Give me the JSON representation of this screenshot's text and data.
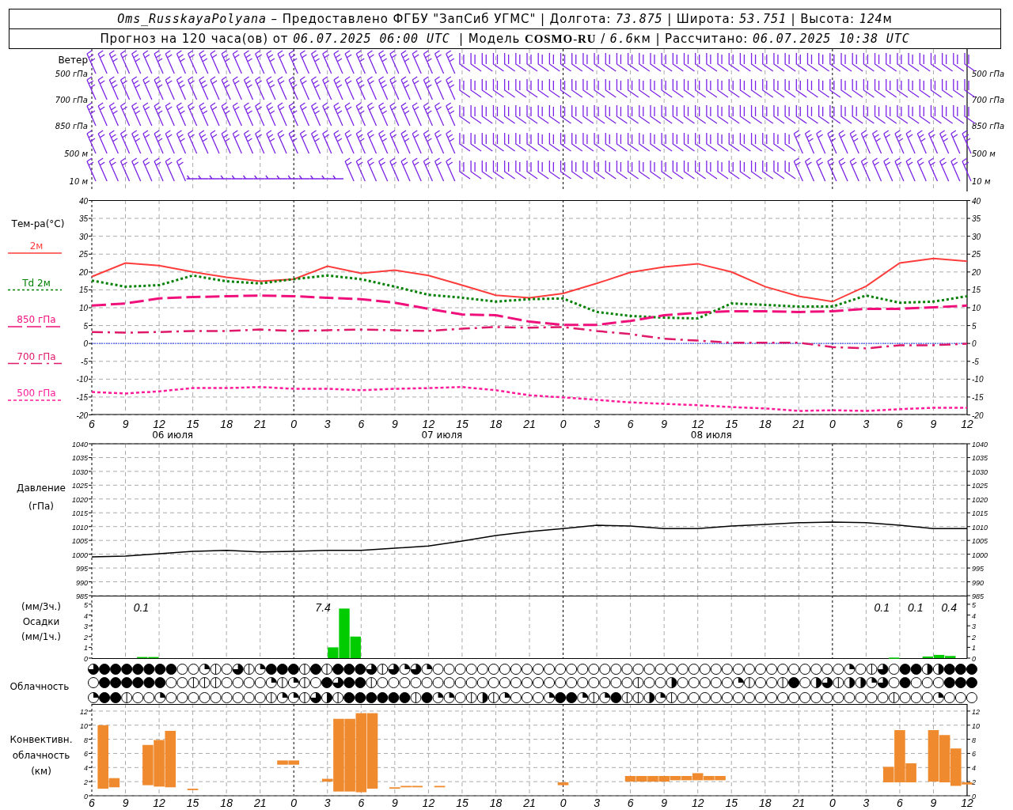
{
  "header": {
    "lines": [
      {
        "parts": [
          {
            "text": "Oms_RusskayaPolyana",
            "kind": "italic"
          },
          {
            "text": " – Предоставлено ФГБУ \"ЗапСиб УГМС\" | Долгота: ",
            "kind": "plain"
          },
          {
            "text": "73.875",
            "kind": "italic"
          },
          {
            "text": " | Широта: ",
            "kind": "plain"
          },
          {
            "text": "53.751",
            "kind": "italic"
          },
          {
            "text": " | Высота: ",
            "kind": "plain"
          },
          {
            "text": "124",
            "kind": "italic"
          },
          {
            "text": "м",
            "kind": "plain"
          }
        ]
      },
      {
        "parts": [
          {
            "text": "Прогноз на 120 часа(ов) от ",
            "kind": "plain"
          },
          {
            "text": "06.07.2025 06:00 UTC",
            "kind": "italic"
          },
          {
            "text": "  | Модель ",
            "kind": "plain"
          },
          {
            "text": "COSMO-RU",
            "kind": "bold"
          },
          {
            "text": " / ",
            "kind": "plain"
          },
          {
            "text": "6.6",
            "kind": "italic"
          },
          {
            "text": "км | Рассчитано: ",
            "kind": "plain"
          },
          {
            "text": "06.07.2025 10:38 UTC",
            "kind": "italic"
          }
        ]
      }
    ]
  },
  "wind": {
    "title": "Ветер",
    "levels": [
      "500 гПа",
      "700 гПа",
      "850 гПа",
      "500 м",
      "10  м"
    ],
    "right_levels": [
      "500 гПа",
      "700 гПа",
      "850 гПа",
      "500 м",
      "10  м"
    ]
  },
  "temperature": {
    "label": "Тем-ра(°C)",
    "dates": [
      "06 июля",
      "07 июля",
      "08 июля"
    ],
    "left_ticks": [
      "40",
      "35",
      "30",
      "25",
      "20",
      "15",
      "10",
      "5",
      "0",
      "-5",
      "-10",
      "-15",
      "-20"
    ],
    "right_ticks": [
      "40",
      "35",
      "30",
      "25",
      "20",
      "15",
      "10",
      "5",
      "0",
      "-5",
      "-10",
      "-15",
      "-20"
    ],
    "chart_data": {
      "type": "line",
      "categories": [
        "6",
        "9",
        "12",
        "15",
        "18",
        "21",
        "0",
        "3",
        "6",
        "9",
        "12",
        "15",
        "18",
        "21",
        "0",
        "3",
        "6",
        "9",
        "12",
        "15",
        "18",
        "21",
        "0",
        "3",
        "6",
        "9",
        "12"
      ],
      "series": [
        {
          "name": "2м",
          "color": "#ff3c3c",
          "line_style": "solid",
          "values": [
            18.7,
            22.5,
            21.8,
            20,
            18.5,
            17.4,
            18,
            21.6,
            19.6,
            20.5,
            19,
            16.3,
            13.5,
            12.8,
            14,
            16.8,
            19.9,
            21.4,
            22.3,
            20,
            15.9,
            13.2,
            11.7,
            16,
            22.5,
            23.8,
            23
          ]
        },
        {
          "name": "Td  2м",
          "color": "#008000",
          "line_style": "dotted",
          "values": [
            17.6,
            15.9,
            16.3,
            19,
            17.4,
            16.8,
            18,
            19,
            18,
            15.9,
            13.6,
            12.8,
            11.7,
            12.4,
            12.6,
            8.8,
            7.7,
            7.2,
            7,
            11.2,
            10.8,
            10.3,
            10.3,
            13.4,
            11.4,
            11.7,
            13.2
          ]
        },
        {
          "name": "850 гПа",
          "color": "#f0107c",
          "line_style": "dashed",
          "values": [
            10.6,
            11.2,
            12.6,
            13,
            13.2,
            13.4,
            13.2,
            12.8,
            12.4,
            11.4,
            9.7,
            8.1,
            7.9,
            6.1,
            5.2,
            5.2,
            6.3,
            7.9,
            8.6,
            9,
            9,
            8.8,
            9,
            9.7,
            9.7,
            10.1,
            10.6
          ]
        },
        {
          "name": "700 гПа",
          "color": "#e0186a",
          "line_style": "dashdot",
          "values": [
            3.2,
            3,
            3.2,
            3.5,
            3.5,
            3.9,
            3.5,
            3.7,
            3.9,
            3.7,
            3.5,
            4.1,
            4.6,
            4.4,
            4.6,
            3.5,
            2.6,
            1.3,
            0.8,
            0.2,
            0.2,
            0.2,
            -1,
            -1.4,
            -0.5,
            -0.5,
            -0.1
          ]
        },
        {
          "name": "500 гПа",
          "color": "#ff1a9a",
          "line_style": "dotted",
          "values": [
            -13.6,
            -14,
            -13.4,
            -12.5,
            -12.5,
            -12.2,
            -12.7,
            -12.7,
            -13.1,
            -12.7,
            -12.5,
            -12.2,
            -13.1,
            -14.5,
            -15.1,
            -15.8,
            -16.5,
            -16.9,
            -17.3,
            -17.8,
            -18.2,
            -18.9,
            -18.7,
            -18.9,
            -18.4,
            -18,
            -18
          ]
        }
      ],
      "ylim": [
        -20,
        40
      ],
      "yticks": [
        -20,
        -15,
        -10,
        -5,
        0,
        5,
        10,
        15,
        20,
        25,
        30,
        35,
        40
      ],
      "grid": true,
      "ref_lines": [
        {
          "axis": "y",
          "value": 0,
          "color": "#3050ff"
        }
      ]
    }
  },
  "pressure": {
    "labels": [
      "Давление",
      "(гПа)"
    ],
    "left_ticks": [
      "1040",
      "1035",
      "1030",
      "1025",
      "1020",
      "1015",
      "1010",
      "1005",
      "1000",
      "995",
      "990",
      "985"
    ],
    "right_ticks": [
      "1040",
      "1035",
      "1030",
      "1025",
      "1020",
      "1015",
      "1010",
      "1005",
      "1000",
      "995",
      "990",
      "985"
    ],
    "chart_data": {
      "type": "line",
      "categories": [
        null,
        null,
        null,
        null,
        null,
        null,
        null,
        null,
        null,
        null,
        null,
        null,
        null,
        null,
        null,
        null,
        null,
        null,
        null,
        null,
        null,
        null,
        null,
        null,
        null,
        null,
        null
      ],
      "series": [
        {
          "color": "#000000",
          "values": [
            999,
            999.3,
            1000.2,
            1001,
            1001.4,
            1000.8,
            1001,
            1001.4,
            1001.4,
            1002.2,
            1003,
            1004.8,
            1006.8,
            1008.2,
            1009.3,
            1010.5,
            1010.2,
            1009.3,
            1009.3,
            1010.2,
            1010.8,
            1011.4,
            1011.6,
            1011.4,
            1010.5,
            1009.3,
            1009.3
          ]
        }
      ],
      "ylim": [
        985,
        1040
      ],
      "yticks": [
        985,
        990,
        995,
        1000,
        1005,
        1010,
        1015,
        1020,
        1025,
        1030,
        1035,
        1040
      ],
      "grid": true
    }
  },
  "precipitation": {
    "labels": [
      "(мм/3ч.)",
      "Осадки",
      "(мм/1ч.)"
    ],
    "left_ticks": [
      "5",
      "4",
      "3",
      "2",
      "1",
      "0"
    ],
    "right_ticks": [
      "5",
      "4",
      "3",
      "2",
      "1",
      "0"
    ],
    "chart_data": {
      "type": "bar",
      "categories": [
        null,
        null,
        null,
        null,
        null,
        null,
        null,
        null,
        null,
        null,
        null,
        null,
        null,
        null,
        null,
        null,
        null,
        null,
        null,
        null,
        null,
        null,
        null,
        null,
        null,
        null,
        null,
        null,
        null,
        null,
        null,
        null,
        null,
        null,
        null,
        null,
        null,
        null,
        null,
        null,
        null,
        null,
        null,
        null,
        null,
        null,
        null,
        null,
        null,
        null,
        null,
        null,
        null,
        null,
        null,
        null,
        null,
        null,
        null,
        null,
        null,
        null,
        null,
        null,
        null,
        null,
        null,
        null,
        null,
        null,
        null,
        null,
        null,
        null,
        null,
        null,
        null,
        null
      ],
      "series": [
        {
          "color": "#00cc00",
          "values": [
            null,
            null,
            null,
            null,
            0.1,
            0.1,
            null,
            null,
            null,
            null,
            null,
            null,
            null,
            null,
            null,
            null,
            null,
            null,
            null,
            null,
            null,
            1,
            4.6,
            2,
            null,
            null,
            null,
            null,
            null,
            null,
            null,
            null,
            null,
            null,
            null,
            null,
            null,
            null,
            null,
            null,
            null,
            null,
            null,
            null,
            null,
            null,
            null,
            null,
            null,
            null,
            null,
            null,
            null,
            null,
            null,
            null,
            null,
            null,
            null,
            null,
            null,
            null,
            null,
            null,
            null,
            null,
            null,
            null,
            null,
            null,
            null,
            0.05,
            null,
            null,
            0.15,
            0.3,
            0.2,
            null
          ]
        }
      ],
      "ylim": [
        0,
        5.8
      ],
      "yticks": [
        0,
        1,
        2,
        3,
        4,
        5
      ],
      "annotations": [
        "0.1",
        "7.4",
        "0.1",
        "0.1",
        "0.4"
      ]
    }
  },
  "clouds": {
    "label": "Облачность",
    "rows": [
      {
        "cells": [
          {
            "kind": "most"
          },
          {
            "kind": "overcast"
          },
          {
            "kind": "overcast"
          },
          {
            "kind": "overcast"
          },
          {
            "kind": "overcast"
          },
          {
            "kind": "overcast"
          },
          {
            "kind": "overcast"
          },
          {
            "kind": "overcast"
          },
          {
            "kind": "clear"
          },
          {
            "kind": "clear"
          },
          {
            "kind": "quarter"
          },
          {
            "kind": "few"
          },
          {
            "kind": "clear"
          },
          {
            "kind": "most"
          },
          {
            "kind": "few"
          },
          {
            "kind": "quarter"
          },
          {
            "kind": "overcast"
          },
          {
            "kind": "overcast"
          },
          {
            "kind": "overcast"
          },
          {
            "kind": "few"
          },
          {
            "kind": "overcast"
          },
          {
            "kind": "few"
          },
          {
            "kind": "overcast"
          },
          {
            "kind": "overcast"
          },
          {
            "kind": "overcast"
          },
          {
            "kind": "most"
          },
          {
            "kind": "few"
          },
          {
            "kind": "most"
          },
          {
            "kind": "quarter"
          },
          {
            "kind": "most"
          },
          {
            "kind": "quarter"
          },
          {
            "kind": "clear"
          },
          {
            "kind": "clear"
          },
          {
            "kind": "clear"
          },
          {
            "kind": "clear"
          },
          {
            "kind": "clear"
          },
          {
            "kind": "clear"
          },
          {
            "kind": "clear"
          },
          {
            "kind": "clear"
          },
          {
            "kind": "clear"
          },
          {
            "kind": "clear"
          },
          {
            "kind": "clear"
          },
          {
            "kind": "clear"
          },
          {
            "kind": "clear"
          },
          {
            "kind": "clear"
          },
          {
            "kind": "clear"
          },
          {
            "kind": "clear"
          },
          {
            "kind": "clear"
          },
          {
            "kind": "clear"
          },
          {
            "kind": "clear"
          },
          {
            "kind": "clear"
          },
          {
            "kind": "clear"
          },
          {
            "kind": "clear"
          },
          {
            "kind": "clear"
          },
          {
            "kind": "clear"
          },
          {
            "kind": "clear"
          },
          {
            "kind": "clear"
          },
          {
            "kind": "clear"
          },
          {
            "kind": "clear"
          },
          {
            "kind": "clear"
          },
          {
            "kind": "clear"
          },
          {
            "kind": "clear"
          },
          {
            "kind": "clear"
          },
          {
            "kind": "clear"
          },
          {
            "kind": "clear"
          },
          {
            "kind": "clear"
          },
          {
            "kind": "clear"
          },
          {
            "kind": "clear"
          },
          {
            "kind": "quarter"
          },
          {
            "kind": "clear"
          },
          {
            "kind": "few"
          },
          {
            "kind": "most"
          },
          {
            "kind": "clear"
          },
          {
            "kind": "overcast"
          },
          {
            "kind": "overcast"
          },
          {
            "kind": "half"
          },
          {
            "kind": "half"
          },
          {
            "kind": "overcast"
          },
          {
            "kind": "overcast"
          },
          {
            "kind": "overcast"
          }
        ]
      },
      {
        "cells": [
          {
            "kind": "clear"
          },
          {
            "kind": "overcast"
          },
          {
            "kind": "overcast"
          },
          {
            "kind": "overcast"
          },
          {
            "kind": "overcast"
          },
          {
            "kind": "overcast"
          },
          {
            "kind": "overcast"
          },
          {
            "kind": "clear"
          },
          {
            "kind": "clear"
          },
          {
            "kind": "few"
          },
          {
            "kind": "few"
          },
          {
            "kind": "few"
          },
          {
            "kind": "clear"
          },
          {
            "kind": "clear"
          },
          {
            "kind": "clear"
          },
          {
            "kind": "clear"
          },
          {
            "kind": "quarter"
          },
          {
            "kind": "few"
          },
          {
            "kind": "quarter"
          },
          {
            "kind": "few"
          },
          {
            "kind": "clear"
          },
          {
            "kind": "overcast"
          },
          {
            "kind": "most"
          },
          {
            "kind": "overcast"
          },
          {
            "kind": "overcast"
          },
          {
            "kind": "few"
          },
          {
            "kind": "clear"
          },
          {
            "kind": "clear"
          },
          {
            "kind": "clear"
          },
          {
            "kind": "clear"
          },
          {
            "kind": "clear"
          },
          {
            "kind": "clear"
          },
          {
            "kind": "clear"
          },
          {
            "kind": "clear"
          },
          {
            "kind": "clear"
          },
          {
            "kind": "clear"
          },
          {
            "kind": "clear"
          },
          {
            "kind": "clear"
          },
          {
            "kind": "clear"
          },
          {
            "kind": "clear"
          },
          {
            "kind": "clear"
          },
          {
            "kind": "clear"
          },
          {
            "kind": "clear"
          },
          {
            "kind": "clear"
          },
          {
            "kind": "clear"
          },
          {
            "kind": "clear"
          },
          {
            "kind": "clear"
          },
          {
            "kind": "clear"
          },
          {
            "kind": "clear"
          },
          {
            "kind": "few"
          },
          {
            "kind": "clear"
          },
          {
            "kind": "clear"
          },
          {
            "kind": "half"
          },
          {
            "kind": "clear"
          },
          {
            "kind": "clear"
          },
          {
            "kind": "clear"
          },
          {
            "kind": "clear"
          },
          {
            "kind": "clear"
          },
          {
            "kind": "quarter"
          },
          {
            "kind": "few"
          },
          {
            "kind": "clear"
          },
          {
            "kind": "clear"
          },
          {
            "kind": "few"
          },
          {
            "kind": "overcast"
          },
          {
            "kind": "clear"
          },
          {
            "kind": "half"
          },
          {
            "kind": "most"
          },
          {
            "kind": "few"
          },
          {
            "kind": "half"
          },
          {
            "kind": "half"
          },
          {
            "kind": "quarter"
          },
          {
            "kind": "most"
          },
          {
            "kind": "clear"
          },
          {
            "kind": "overcast"
          },
          {
            "kind": "clear"
          },
          {
            "kind": "clear"
          },
          {
            "kind": "clear"
          },
          {
            "kind": "overcast"
          },
          {
            "kind": "overcast"
          },
          {
            "kind": "overcast"
          }
        ]
      },
      {
        "cells": [
          {
            "kind": "quarter"
          },
          {
            "kind": "overcast"
          },
          {
            "kind": "overcast"
          },
          {
            "kind": "few"
          },
          {
            "kind": "clear"
          },
          {
            "kind": "clear"
          },
          {
            "kind": "quarter"
          },
          {
            "kind": "clear"
          },
          {
            "kind": "clear"
          },
          {
            "kind": "clear"
          },
          {
            "kind": "clear"
          },
          {
            "kind": "clear"
          },
          {
            "kind": "clear"
          },
          {
            "kind": "clear"
          },
          {
            "kind": "clear"
          },
          {
            "kind": "clear"
          },
          {
            "kind": "few"
          },
          {
            "kind": "quarter"
          },
          {
            "kind": "quarter"
          },
          {
            "kind": "few"
          },
          {
            "kind": "most"
          },
          {
            "kind": "half"
          },
          {
            "kind": "few"
          },
          {
            "kind": "overcast"
          },
          {
            "kind": "overcast"
          },
          {
            "kind": "overcast"
          },
          {
            "kind": "overcast"
          },
          {
            "kind": "overcast"
          },
          {
            "kind": "overcast"
          },
          {
            "kind": "few"
          },
          {
            "kind": "overcast"
          },
          {
            "kind": "quarter"
          },
          {
            "kind": "quarter"
          },
          {
            "kind": "clear"
          },
          {
            "kind": "few"
          },
          {
            "kind": "half"
          },
          {
            "kind": "few"
          },
          {
            "kind": "quarter"
          },
          {
            "kind": "clear"
          },
          {
            "kind": "clear"
          },
          {
            "kind": "clear"
          },
          {
            "kind": "quarter"
          },
          {
            "kind": "overcast"
          },
          {
            "kind": "overcast"
          },
          {
            "kind": "quarter"
          },
          {
            "kind": "few"
          },
          {
            "kind": "quarter"
          },
          {
            "kind": "overcast"
          },
          {
            "kind": "few"
          },
          {
            "kind": "few"
          },
          {
            "kind": "half"
          },
          {
            "kind": "quarter"
          },
          {
            "kind": "few"
          },
          {
            "kind": "clear"
          },
          {
            "kind": "clear"
          },
          {
            "kind": "clear"
          },
          {
            "kind": "clear"
          },
          {
            "kind": "clear"
          },
          {
            "kind": "clear"
          },
          {
            "kind": "clear"
          },
          {
            "kind": "clear"
          },
          {
            "kind": "clear"
          },
          {
            "kind": "clear"
          },
          {
            "kind": "clear"
          },
          {
            "kind": "clear"
          },
          {
            "kind": "clear"
          },
          {
            "kind": "clear"
          },
          {
            "kind": "clear"
          },
          {
            "kind": "clear"
          },
          {
            "kind": "clear"
          },
          {
            "kind": "clear"
          },
          {
            "kind": "clear"
          },
          {
            "kind": "few"
          },
          {
            "kind": "clear"
          },
          {
            "kind": "clear"
          },
          {
            "kind": "clear"
          },
          {
            "kind": "quarter"
          },
          {
            "kind": "clear"
          },
          {
            "kind": "clear"
          },
          {
            "kind": "clear"
          }
        ]
      }
    ]
  },
  "convective": {
    "labels": [
      "Конвективн.",
      "облачность",
      "(км)"
    ],
    "left_ticks": [
      "12",
      "10",
      "8",
      "6",
      "4",
      "2",
      "0"
    ],
    "right_ticks": [
      "12",
      "10",
      "8",
      "6",
      "4",
      "2",
      "0"
    ],
    "chart_data": {
      "type": "candlestick",
      "categories": [
        "6",
        null,
        null,
        "9",
        null,
        null,
        "12",
        null,
        null,
        "15",
        null,
        null,
        "18",
        null,
        null,
        "21",
        null,
        null,
        "0",
        null,
        null,
        "3",
        null,
        null,
        "6",
        null,
        null,
        "9",
        null,
        null,
        "12",
        null,
        null,
        "15",
        null,
        null,
        "18",
        null,
        null,
        "21",
        null,
        null,
        "0",
        null,
        null,
        "3",
        null,
        null,
        "6",
        null,
        null,
        "9",
        null,
        null,
        "12",
        null,
        null,
        "15",
        null,
        null,
        "18",
        null,
        null,
        "21",
        null,
        null,
        "0",
        null,
        null,
        "3",
        null,
        null,
        "6",
        null,
        null,
        "9",
        null,
        null,
        "12"
      ],
      "series": [
        {
          "color": "#f08a2e",
          "ohlc": [
            null,
            [
              1,
              10,
              1,
              10
            ],
            [
              1.2,
              2.5,
              1.2,
              2.5
            ],
            null,
            null,
            [
              1.5,
              7.2,
              1.5,
              7.2
            ],
            [
              1.3,
              7.9,
              1.3,
              7.9
            ],
            [
              1.2,
              9.2,
              1.2,
              9.2
            ],
            null,
            [
              0.8,
              1,
              0.8,
              1
            ],
            null,
            null,
            null,
            null,
            null,
            null,
            null,
            [
              4.4,
              5,
              4.4,
              5
            ],
            [
              4.4,
              5,
              4.4,
              5
            ],
            null,
            null,
            [
              2,
              2.4,
              2,
              2.4
            ],
            [
              0.6,
              10.9,
              0.6,
              10.9
            ],
            [
              0.6,
              10.9,
              0.6,
              10.9
            ],
            [
              0.5,
              11.7,
              0.5,
              11.7
            ],
            [
              1,
              11.7,
              1,
              11.7
            ],
            null,
            [
              1,
              1.2,
              1,
              1.2
            ],
            [
              1.2,
              1.4,
              1.2,
              1.4
            ],
            [
              1.2,
              1.4,
              1.2,
              1.4
            ],
            null,
            [
              1.2,
              1.4,
              1.2,
              1.4
            ],
            null,
            null,
            null,
            null,
            null,
            null,
            null,
            null,
            null,
            null,
            [
              1.5,
              1.9,
              1.5,
              1.9
            ],
            null,
            null,
            null,
            null,
            null,
            [
              2,
              2.8,
              2,
              2.8
            ],
            [
              2,
              2.8,
              2,
              2.8
            ],
            [
              2,
              2.8,
              2,
              2.8
            ],
            [
              2,
              2.8,
              2,
              2.8
            ],
            [
              2.2,
              2.8,
              2.2,
              2.8
            ],
            [
              2.2,
              2.8,
              2.2,
              2.8
            ],
            [
              2.2,
              3.2,
              2.2,
              3.2
            ],
            [
              2.2,
              2.8,
              2.2,
              2.8
            ],
            [
              2.2,
              2.8,
              2.2,
              2.8
            ],
            null,
            null,
            null,
            null,
            null,
            null,
            null,
            null,
            null,
            null,
            null,
            null,
            null,
            null,
            [
              1.9,
              4.1,
              1.9,
              4.1
            ],
            [
              1.9,
              9.3,
              1.9,
              9.3
            ],
            [
              1.9,
              4.6,
              1.9,
              4.6
            ],
            null,
            [
              2,
              9.3,
              2,
              9.3
            ],
            [
              1.9,
              8.6,
              1.9,
              8.6
            ],
            [
              1.4,
              6.7,
              1.4,
              6.7
            ],
            [
              1.6,
              1.9,
              1.6,
              1.9
            ]
          ]
        }
      ],
      "ylim": [
        0,
        13
      ],
      "yticks": [
        0,
        2,
        4,
        6,
        8,
        10,
        12
      ],
      "grid": true
    }
  }
}
